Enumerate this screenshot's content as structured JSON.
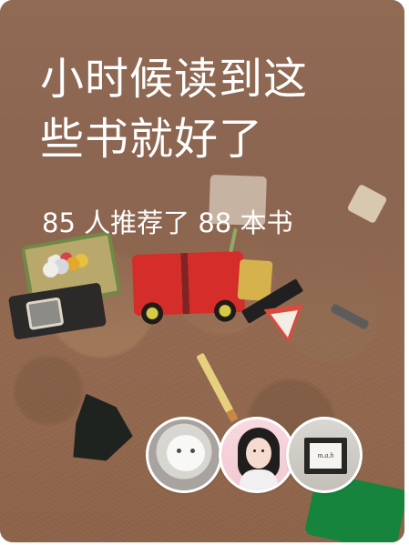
{
  "card": {
    "title_line_1": "小时候读到这",
    "title_line_2": "些书就好了",
    "subtitle": "85 人推荐了 88 本书"
  },
  "avatars": {
    "items": [
      {
        "icon": "cat-avatar"
      },
      {
        "icon": "girl-avatar"
      },
      {
        "icon": "frame-avatar",
        "caption": "m.a.h"
      }
    ]
  }
}
